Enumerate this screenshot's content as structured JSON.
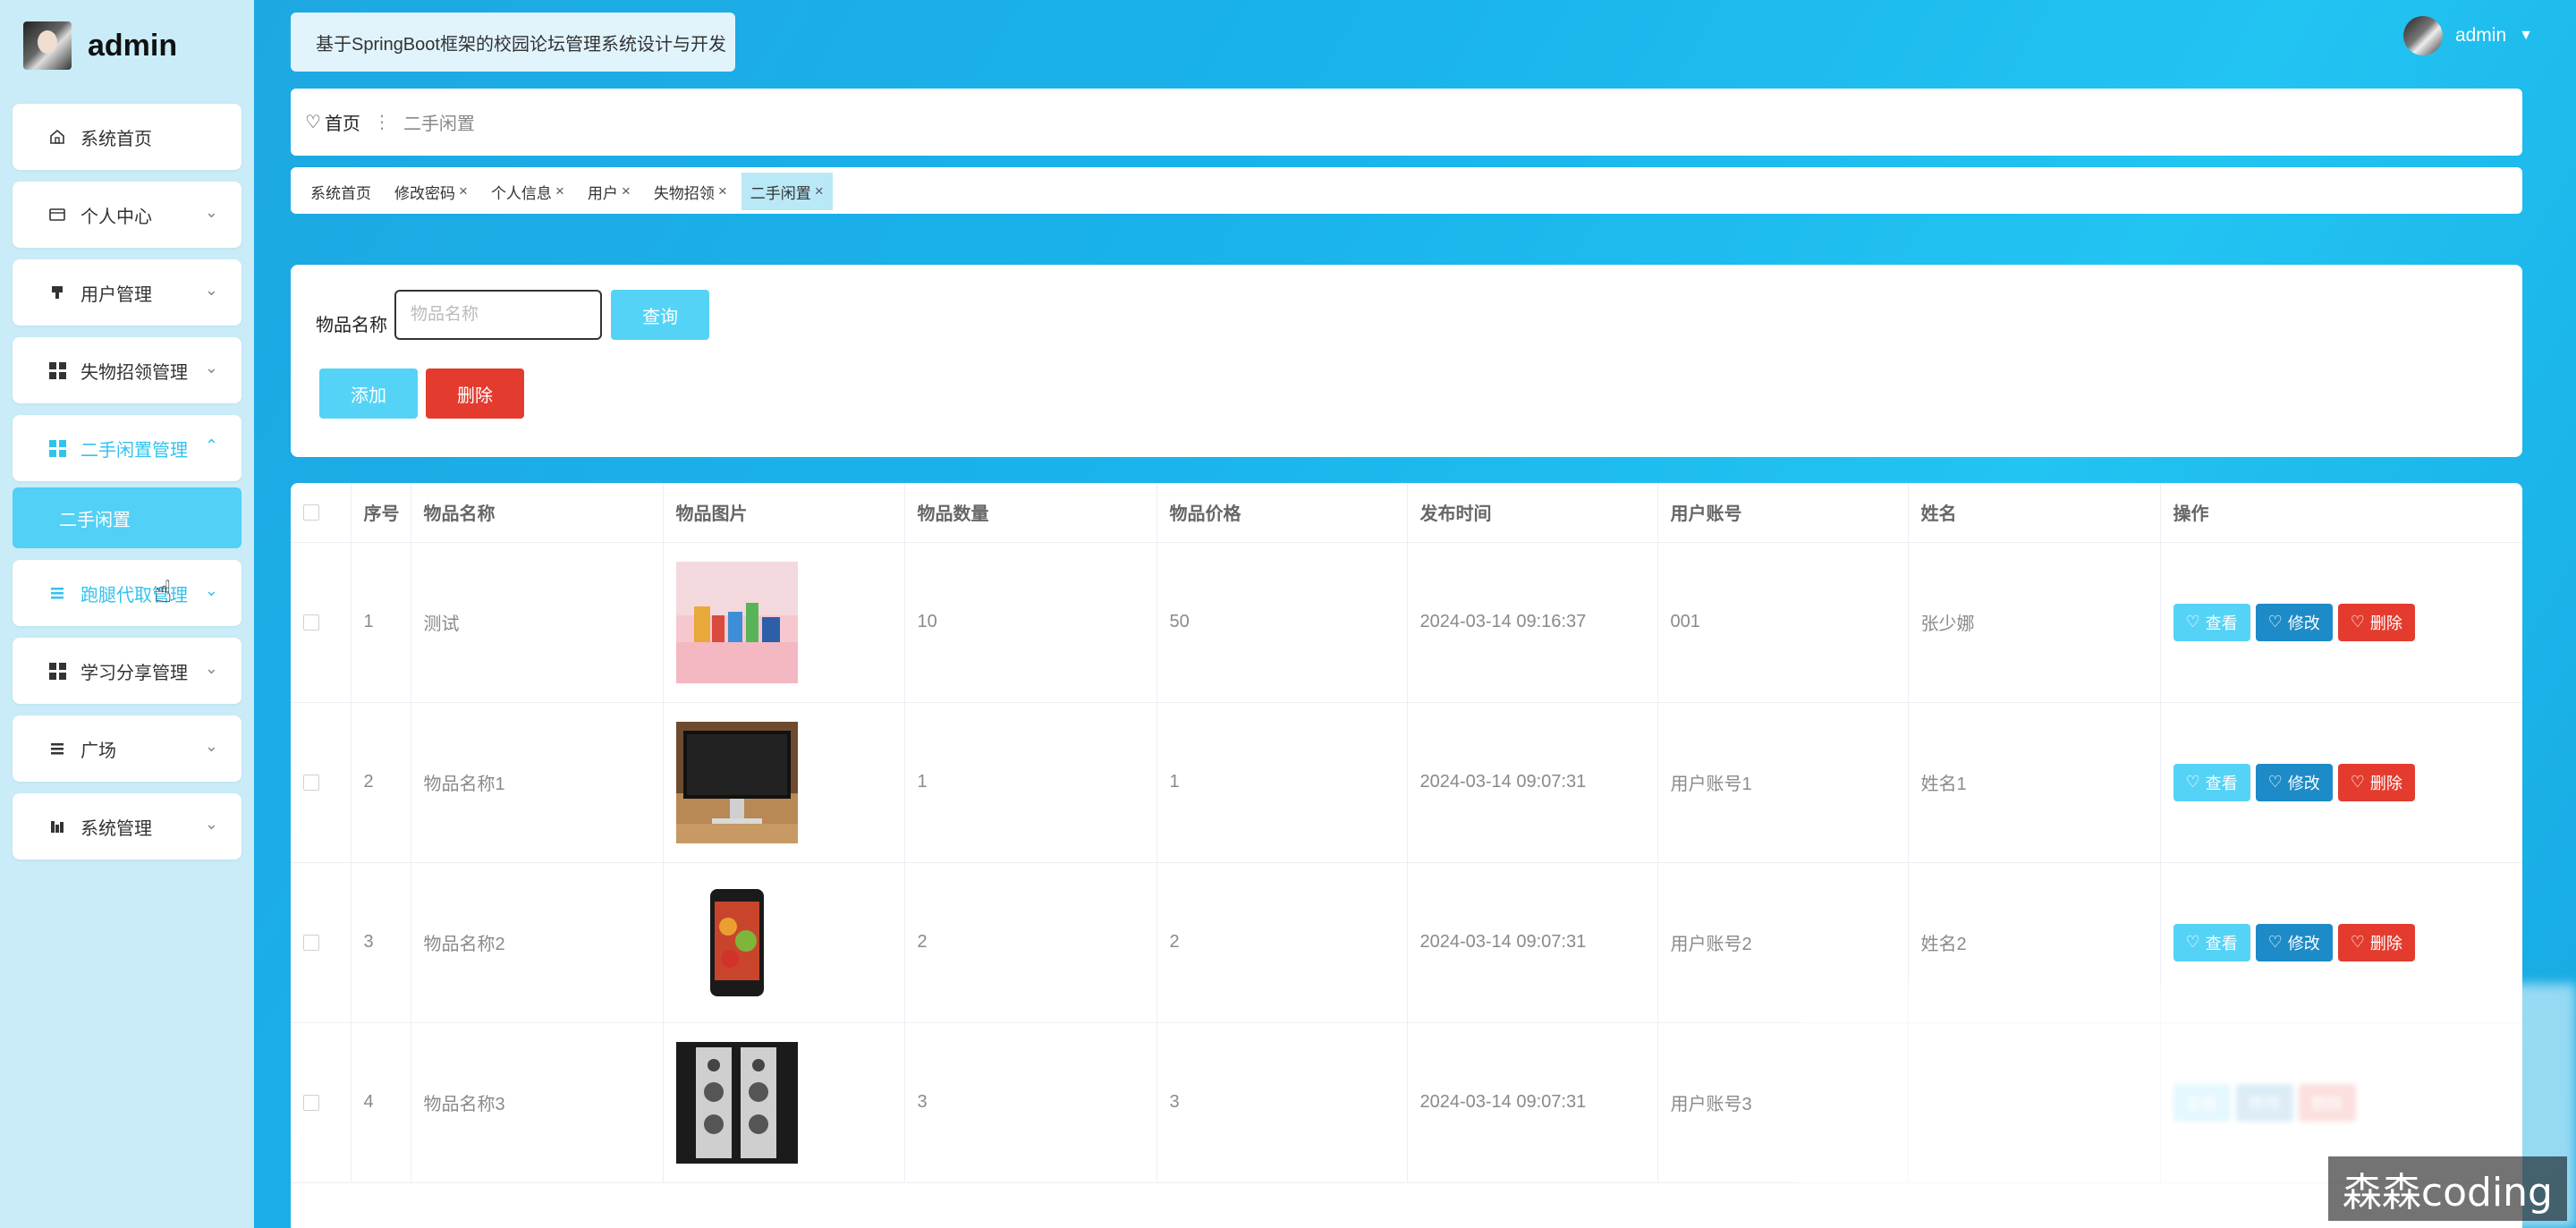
{
  "brand": {
    "name": "admin"
  },
  "header": {
    "title": "基于SpringBoot框架的校园论坛管理系统设计与开发",
    "user": "admin"
  },
  "sidebar": {
    "items": [
      {
        "label": "系统首页",
        "icon": "home-icon"
      },
      {
        "label": "个人中心",
        "icon": "wallet-icon"
      },
      {
        "label": "用户管理",
        "icon": "user-mgmt-icon"
      },
      {
        "label": "失物招领管理",
        "icon": "grid-icon"
      },
      {
        "label": "二手闲置管理",
        "icon": "grid-icon",
        "active": true
      },
      {
        "label": "跑腿代取管理",
        "icon": "list-icon"
      },
      {
        "label": "学习分享管理",
        "icon": "grid-icon"
      },
      {
        "label": "广场",
        "icon": "list-icon"
      },
      {
        "label": "系统管理",
        "icon": "chart-icon"
      }
    ],
    "submenu": {
      "label": "二手闲置"
    }
  },
  "breadcrumb": {
    "home": "首页",
    "current": "二手闲置"
  },
  "tags": [
    {
      "label": "系统首页",
      "closable": false
    },
    {
      "label": "修改密码",
      "closable": true
    },
    {
      "label": "个人信息",
      "closable": true
    },
    {
      "label": "用户",
      "closable": true
    },
    {
      "label": "失物招领",
      "closable": true
    },
    {
      "label": "二手闲置",
      "closable": true,
      "active": true
    }
  ],
  "search": {
    "label": "物品名称",
    "placeholder": "物品名称",
    "query_label": "查询",
    "add_label": "添加",
    "delete_label": "删除"
  },
  "table": {
    "columns": [
      "序号",
      "物品名称",
      "物品图片",
      "物品数量",
      "物品价格",
      "发布时间",
      "用户账号",
      "姓名",
      "操作"
    ],
    "rows": [
      {
        "index": "1",
        "name": "测试",
        "image": "toys-photo",
        "quantity": "10",
        "price": "50",
        "time": "2024-03-14 09:16:37",
        "account": "001",
        "real_name": "张少娜"
      },
      {
        "index": "2",
        "name": "物品名称1",
        "image": "monitor-photo",
        "quantity": "1",
        "price": "1",
        "time": "2024-03-14 09:07:31",
        "account": "用户账号1",
        "real_name": "姓名1"
      },
      {
        "index": "3",
        "name": "物品名称2",
        "image": "phone-photo",
        "quantity": "2",
        "price": "2",
        "time": "2024-03-14 09:07:31",
        "account": "用户账号2",
        "real_name": "姓名2"
      },
      {
        "index": "4",
        "name": "物品名称3",
        "image": "speakers-photo",
        "quantity": "3",
        "price": "3",
        "time": "2024-03-14 09:07:31",
        "account": "用户账号3",
        "real_name": ""
      }
    ],
    "actions": {
      "view": "查看",
      "edit": "修改",
      "delete": "删除"
    }
  },
  "watermark": "森森coding",
  "colors": {
    "accent": "#55d3f6",
    "edit": "#1d8bc8",
    "danger": "#e33c2f",
    "sidebar": "#c9ecf8"
  }
}
